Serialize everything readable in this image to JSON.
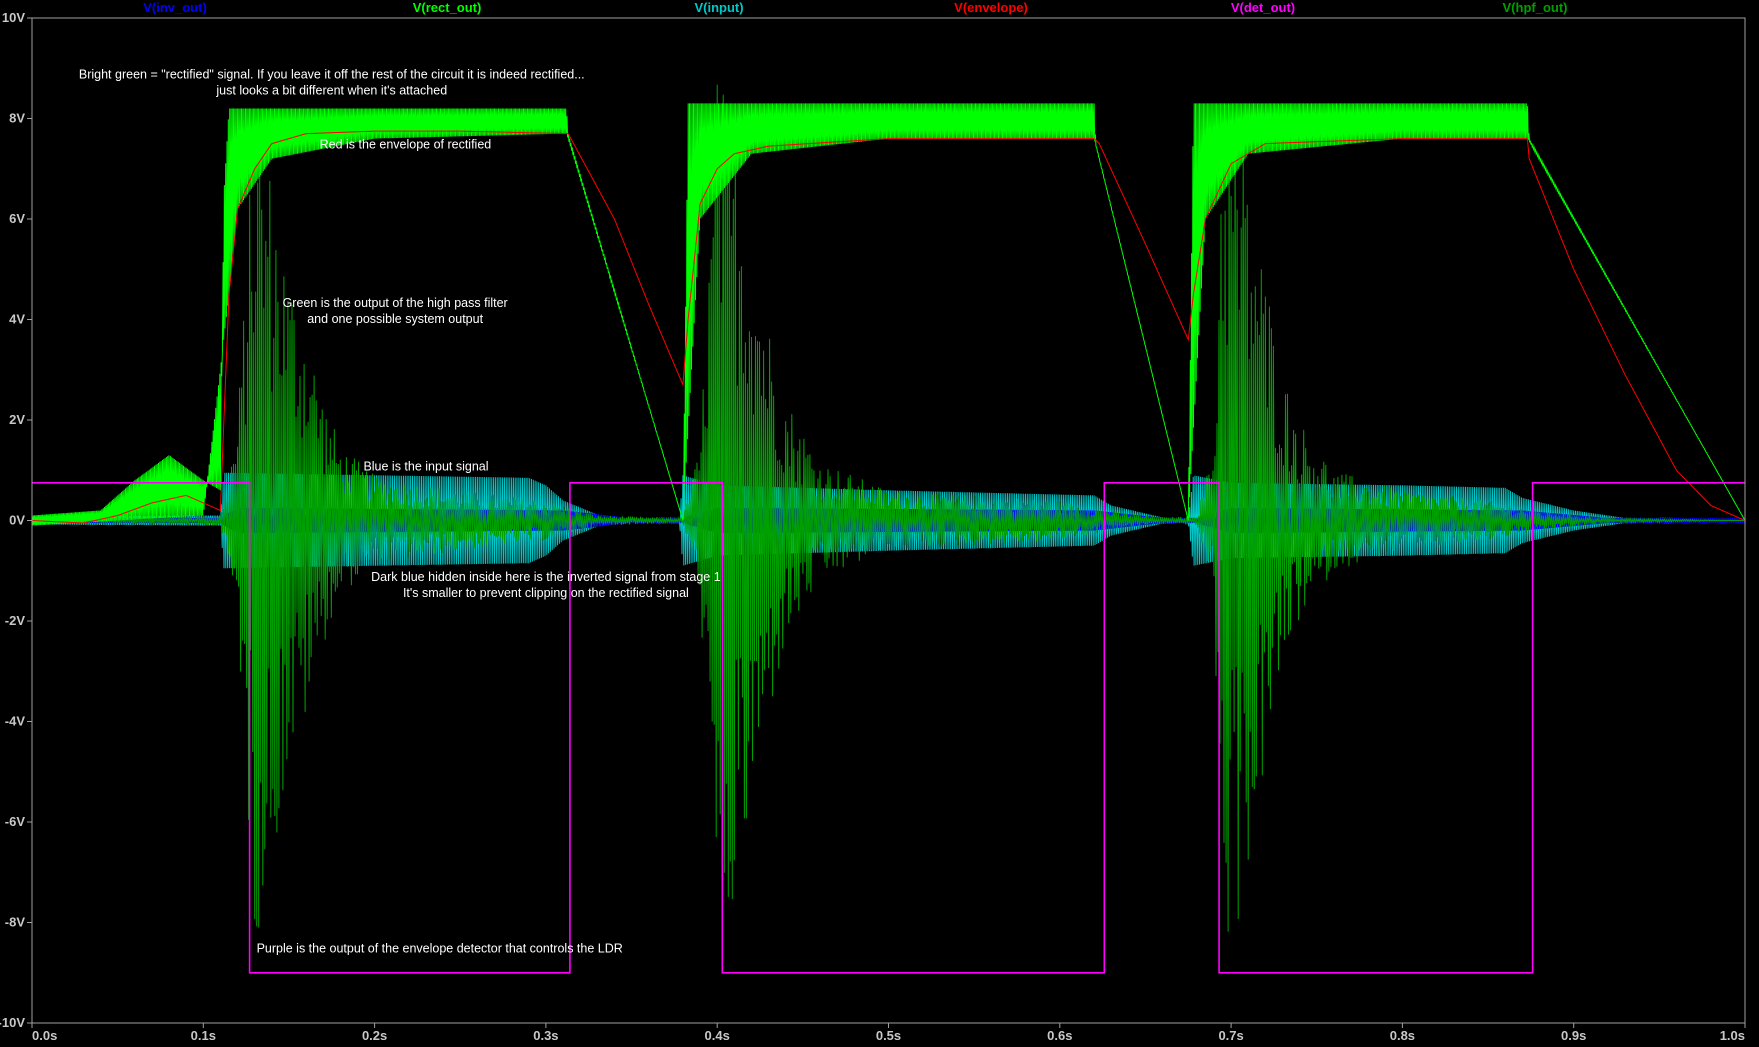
{
  "chart_data": {
    "type": "line",
    "title": "",
    "xlabel": "",
    "ylabel": "",
    "xlim": [
      0.0,
      1.0
    ],
    "ylim": [
      -10,
      10
    ],
    "grid": false,
    "legend": "top",
    "x_ticks": [
      "0.0s",
      "0.1s",
      "0.2s",
      "0.3s",
      "0.4s",
      "0.5s",
      "0.6s",
      "0.7s",
      "0.8s",
      "0.9s",
      "1.0s"
    ],
    "y_ticks": [
      "10V",
      "8V",
      "6V",
      "4V",
      "2V",
      "0V",
      "-2V",
      "-4V",
      "-6V",
      "-8V",
      "-10V"
    ],
    "series": [
      {
        "name": "V(inv_out)",
        "color": "#0000ff",
        "envelope": [
          [
            0.0,
            0.05
          ],
          [
            0.11,
            0.05
          ],
          [
            0.12,
            0.25
          ],
          [
            0.31,
            0.2
          ],
          [
            0.35,
            0.05
          ],
          [
            0.38,
            0.05
          ],
          [
            0.4,
            0.25
          ],
          [
            0.62,
            0.2
          ],
          [
            0.66,
            0.05
          ],
          [
            0.68,
            0.05
          ],
          [
            0.7,
            0.25
          ],
          [
            0.87,
            0.2
          ],
          [
            0.92,
            0.05
          ],
          [
            1.0,
            0.05
          ]
        ]
      },
      {
        "name": "V(rect_out)",
        "color": "#00ff00",
        "peaks": [
          [
            0.0,
            0.1
          ],
          [
            0.04,
            0.2
          ],
          [
            0.06,
            0.8
          ],
          [
            0.08,
            1.3
          ],
          [
            0.1,
            0.8
          ],
          [
            0.11,
            0.6
          ],
          [
            0.112,
            6.5
          ],
          [
            0.115,
            8.2
          ],
          [
            0.312,
            8.2
          ],
          [
            0.313,
            7.7
          ],
          [
            0.38,
            0.0
          ],
          [
            0.383,
            8.3
          ],
          [
            0.62,
            8.3
          ],
          [
            0.621,
            7.5
          ],
          [
            0.675,
            0.0
          ],
          [
            0.678,
            8.3
          ],
          [
            0.873,
            8.3
          ],
          [
            0.874,
            7.6
          ],
          [
            1.0,
            0.0
          ]
        ],
        "troughs": [
          [
            0.0,
            -0.1
          ],
          [
            0.1,
            0.1
          ],
          [
            0.115,
            4.5
          ],
          [
            0.12,
            6.2
          ],
          [
            0.14,
            7.2
          ],
          [
            0.2,
            7.6
          ],
          [
            0.312,
            7.7
          ],
          [
            0.38,
            0.0
          ],
          [
            0.39,
            6.0
          ],
          [
            0.42,
            7.3
          ],
          [
            0.5,
            7.6
          ],
          [
            0.62,
            7.6
          ],
          [
            0.675,
            0.0
          ],
          [
            0.685,
            6.0
          ],
          [
            0.71,
            7.3
          ],
          [
            0.8,
            7.6
          ],
          [
            0.873,
            7.6
          ],
          [
            1.0,
            0.0
          ]
        ]
      },
      {
        "name": "V(input)",
        "color": "#00c8c8",
        "envelope": [
          [
            0.0,
            0.08
          ],
          [
            0.11,
            0.1
          ],
          [
            0.112,
            0.95
          ],
          [
            0.29,
            0.85
          ],
          [
            0.3,
            0.7
          ],
          [
            0.31,
            0.4
          ],
          [
            0.33,
            0.12
          ],
          [
            0.35,
            0.04
          ],
          [
            0.378,
            0.03
          ],
          [
            0.38,
            0.9
          ],
          [
            0.4,
            0.7
          ],
          [
            0.5,
            0.6
          ],
          [
            0.62,
            0.5
          ],
          [
            0.63,
            0.3
          ],
          [
            0.66,
            0.06
          ],
          [
            0.675,
            0.04
          ],
          [
            0.678,
            0.9
          ],
          [
            0.7,
            0.75
          ],
          [
            0.8,
            0.7
          ],
          [
            0.86,
            0.65
          ],
          [
            0.87,
            0.45
          ],
          [
            0.9,
            0.2
          ],
          [
            0.93,
            0.05
          ],
          [
            1.0,
            0.0
          ]
        ]
      },
      {
        "name": "V(envelope)",
        "color": "#ff0000",
        "points": [
          [
            0.0,
            0.0
          ],
          [
            0.03,
            -0.05
          ],
          [
            0.05,
            0.1
          ],
          [
            0.07,
            0.35
          ],
          [
            0.09,
            0.5
          ],
          [
            0.1,
            0.35
          ],
          [
            0.11,
            0.2
          ],
          [
            0.112,
            2.0
          ],
          [
            0.115,
            4.5
          ],
          [
            0.12,
            6.2
          ],
          [
            0.13,
            7.0
          ],
          [
            0.14,
            7.5
          ],
          [
            0.16,
            7.7
          ],
          [
            0.2,
            7.75
          ],
          [
            0.25,
            7.75
          ],
          [
            0.313,
            7.7
          ],
          [
            0.34,
            6.0
          ],
          [
            0.36,
            4.3
          ],
          [
            0.38,
            2.7
          ],
          [
            0.383,
            4.0
          ],
          [
            0.39,
            6.3
          ],
          [
            0.4,
            7.0
          ],
          [
            0.41,
            7.3
          ],
          [
            0.43,
            7.45
          ],
          [
            0.5,
            7.6
          ],
          [
            0.62,
            7.6
          ],
          [
            0.623,
            7.5
          ],
          [
            0.65,
            5.5
          ],
          [
            0.675,
            3.6
          ],
          [
            0.678,
            4.5
          ],
          [
            0.685,
            6.0
          ],
          [
            0.7,
            7.1
          ],
          [
            0.72,
            7.5
          ],
          [
            0.8,
            7.6
          ],
          [
            0.873,
            7.6
          ],
          [
            0.874,
            7.2
          ],
          [
            0.9,
            5.0
          ],
          [
            0.93,
            2.9
          ],
          [
            0.96,
            1.0
          ],
          [
            0.98,
            0.3
          ],
          [
            1.0,
            0.0
          ]
        ]
      },
      {
        "name": "V(det_out)",
        "color": "#ff00ff",
        "points": [
          [
            0.0,
            0.75
          ],
          [
            0.127,
            0.75
          ],
          [
            0.127,
            -9.0
          ],
          [
            0.314,
            -9.0
          ],
          [
            0.314,
            0.75
          ],
          [
            0.403,
            0.75
          ],
          [
            0.403,
            -9.0
          ],
          [
            0.626,
            -9.0
          ],
          [
            0.626,
            0.75
          ],
          [
            0.693,
            0.75
          ],
          [
            0.693,
            -9.0
          ],
          [
            0.876,
            -9.0
          ],
          [
            0.876,
            0.75
          ],
          [
            1.0,
            0.75
          ]
        ]
      },
      {
        "name": "V(hpf_out)",
        "color": "#00a000",
        "envelope": [
          [
            0.0,
            0.05
          ],
          [
            0.11,
            0.1
          ],
          [
            0.12,
            2.0
          ],
          [
            0.13,
            8.5
          ],
          [
            0.14,
            7.0
          ],
          [
            0.15,
            5.0
          ],
          [
            0.16,
            4.0
          ],
          [
            0.17,
            2.5
          ],
          [
            0.18,
            1.5
          ],
          [
            0.2,
            0.9
          ],
          [
            0.25,
            0.6
          ],
          [
            0.3,
            0.4
          ],
          [
            0.33,
            0.1
          ],
          [
            0.38,
            0.05
          ],
          [
            0.39,
            1.5
          ],
          [
            0.4,
            9.0
          ],
          [
            0.41,
            8.0
          ],
          [
            0.42,
            6.0
          ],
          [
            0.43,
            4.0
          ],
          [
            0.44,
            2.5
          ],
          [
            0.46,
            1.2
          ],
          [
            0.5,
            0.6
          ],
          [
            0.6,
            0.4
          ],
          [
            0.63,
            0.2
          ],
          [
            0.66,
            0.05
          ],
          [
            0.68,
            0.1
          ],
          [
            0.69,
            1.5
          ],
          [
            0.695,
            9.0
          ],
          [
            0.705,
            8.0
          ],
          [
            0.72,
            5.0
          ],
          [
            0.73,
            3.0
          ],
          [
            0.74,
            2.0
          ],
          [
            0.76,
            1.0
          ],
          [
            0.8,
            0.6
          ],
          [
            0.85,
            0.4
          ],
          [
            0.88,
            0.2
          ],
          [
            0.92,
            0.05
          ],
          [
            1.0,
            0.0
          ]
        ]
      }
    ],
    "annotations": [
      {
        "lines": [
          "Bright green  = \"rectified\" signal. If you leave it off the rest of the circuit it is indeed rectified...",
          "just looks a bit different when it's attached"
        ],
        "x": 0.175,
        "y": 8.8
      },
      {
        "lines": [
          "Red is the envelope of rectified"
        ],
        "x": 0.218,
        "y": 7.4
      },
      {
        "lines": [
          "Green is the output of the high pass filter",
          "and one possible system output"
        ],
        "x": 0.212,
        "y": 4.25
      },
      {
        "lines": [
          "Blue is the input signal"
        ],
        "x": 0.23,
        "y": 1.0
      },
      {
        "lines": [
          "Dark blue hidden inside here is the inverted signal from stage 1",
          "It's smaller to prevent clipping on the rectified signal"
        ],
        "x": 0.3,
        "y": -1.2
      },
      {
        "lines": [
          "Purple is the output of the envelope detector that controls the LDR"
        ],
        "x": 0.238,
        "y": -8.6
      }
    ]
  }
}
